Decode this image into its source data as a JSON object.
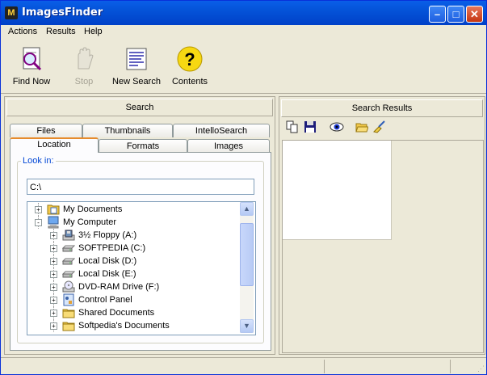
{
  "window": {
    "title": "ImagesFinder",
    "app_icon": "M"
  },
  "menu": [
    {
      "label": "Actions"
    },
    {
      "label": "Results"
    },
    {
      "label": "Help"
    }
  ],
  "toolbar": {
    "find_now": "Find Now",
    "stop": "Stop",
    "new_search": "New Search",
    "contents": "Contents"
  },
  "search_panel": {
    "header": "Search",
    "tabs_back": [
      "Files",
      "Thumbnails",
      "IntelloSearch"
    ],
    "tabs_front": [
      "Location",
      "Formats",
      "Images"
    ],
    "active_tab": "Location",
    "look_in_label": "Look in:",
    "look_in_value": "C:\\",
    "tree": [
      {
        "label": "My Documents",
        "icon": "my-documents-icon",
        "level": 0,
        "toggle": "+"
      },
      {
        "label": "My Computer",
        "icon": "my-computer-icon",
        "level": 0,
        "toggle": "-"
      },
      {
        "label": "3½ Floppy (A:)",
        "icon": "floppy-drive-icon",
        "level": 1,
        "toggle": "+"
      },
      {
        "label": "SOFTPEDIA (C:)",
        "icon": "hard-drive-icon",
        "level": 1,
        "toggle": "+"
      },
      {
        "label": "Local Disk (D:)",
        "icon": "hard-drive-icon",
        "level": 1,
        "toggle": "+"
      },
      {
        "label": "Local Disk (E:)",
        "icon": "hard-drive-icon",
        "level": 1,
        "toggle": "+"
      },
      {
        "label": "DVD-RAM Drive (F:)",
        "icon": "dvd-drive-icon",
        "level": 1,
        "toggle": "+"
      },
      {
        "label": "Control Panel",
        "icon": "control-panel-icon",
        "level": 1,
        "toggle": "+"
      },
      {
        "label": "Shared Documents",
        "icon": "folder-icon",
        "level": 1,
        "toggle": "+"
      },
      {
        "label": "Softpedia's Documents",
        "icon": "folder-icon",
        "level": 1,
        "toggle": "+"
      }
    ]
  },
  "results_panel": {
    "header": "Search Results"
  },
  "colors": {
    "titlebar": "#0453d8",
    "face": "#ece9d8",
    "accent_tab": "#e68b2c",
    "legend": "#0046d5"
  }
}
